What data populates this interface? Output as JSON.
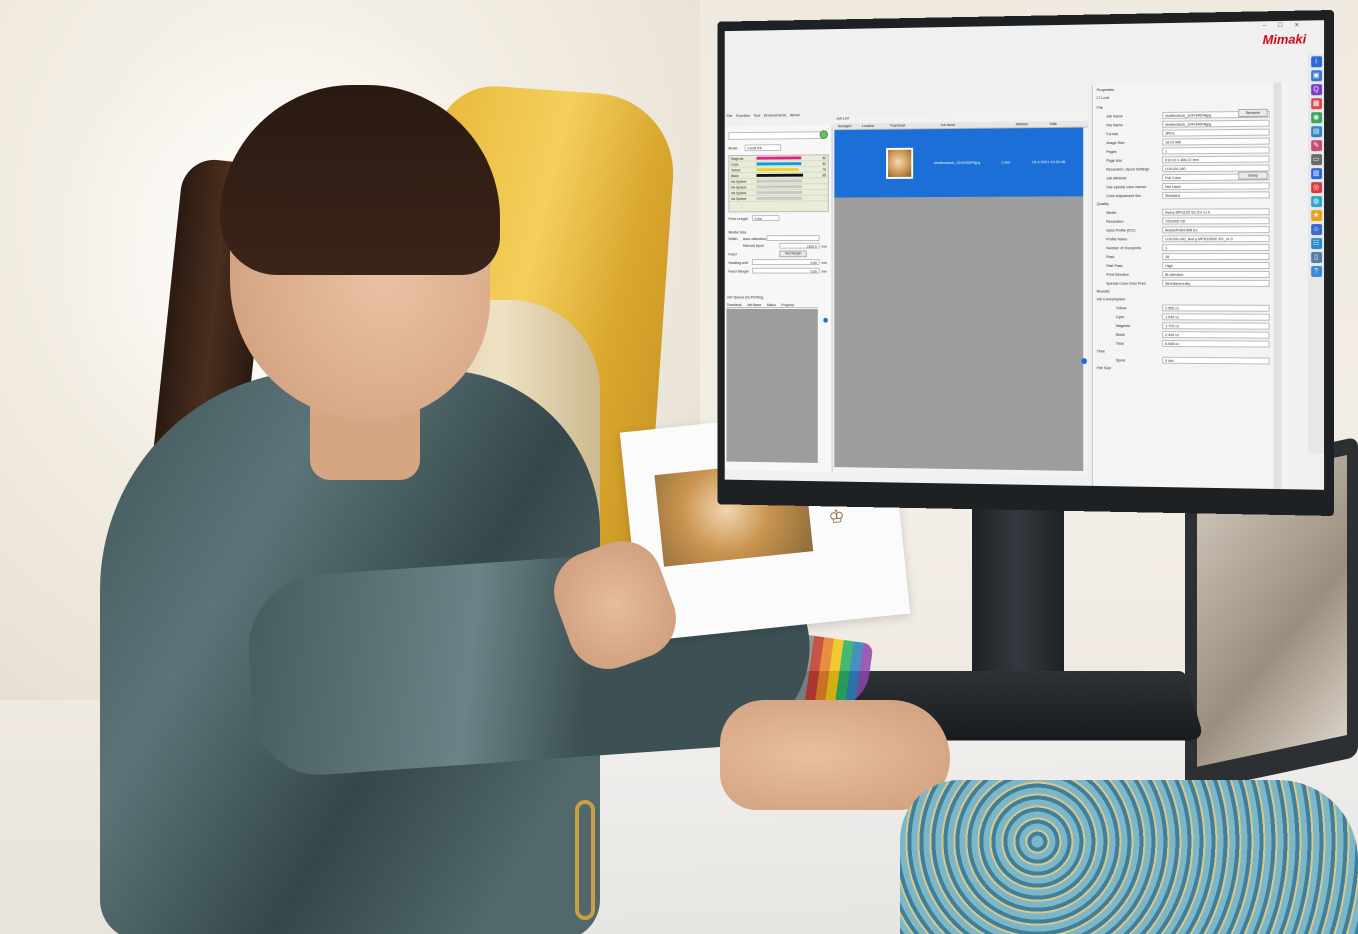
{
  "window": {
    "brand": "Mimaki",
    "controls": "–  ☐  ✕"
  },
  "menu": [
    "File",
    "Function",
    "Tool",
    "Environments",
    "About"
  ],
  "left_panel": {
    "mode_label": "Mode",
    "mode_value": "Local ink",
    "inks": [
      {
        "name": "Magenta",
        "color": "#e0218a",
        "value": "82"
      },
      {
        "name": "Cyan",
        "color": "#00a0e0",
        "value": "81"
      },
      {
        "name": "Yellow",
        "color": "#f3d11a",
        "value": "76"
      },
      {
        "name": "Black",
        "color": "#111111",
        "value": "85"
      },
      {
        "name": "Ink Sphere",
        "color": "#c8c8c8",
        "value": ""
      },
      {
        "name": "Ink Sphere",
        "color": "#c8c8c8",
        "value": ""
      },
      {
        "name": "Ink Sphere",
        "color": "#c8c8c8",
        "value": ""
      },
      {
        "name": "Ink Sphere",
        "color": "#c8c8c8",
        "value": ""
      }
    ],
    "print_length_label": "Print Length",
    "print_length_value": "0.0m",
    "media_size_label": "Media Size",
    "width_label": "Width",
    "auto_detection": "Auto detection",
    "manual_input": "Manual input",
    "width_value": "1620.0",
    "feed_label": "Feed",
    "test_margin": "Test Margin",
    "heating_unit_label": "Heating unit",
    "heating_unit_value": "0.00",
    "feed_margin_label": "Feed Margin",
    "feed_margin_value": "0.00",
    "unit_mm": "mm",
    "queue_title": "Job Queue (0) Printing",
    "queue_headers": [
      "Thumbnail",
      "Job Name",
      "Status",
      "Progress"
    ]
  },
  "job_list": {
    "tab_label": "Job List",
    "headers": [
      "Arranged",
      "Location",
      "Thumbnail",
      "Job Name",
      "Attribute",
      "Date"
    ],
    "rows": [
      {
        "name": "shutterstock_1244340FAjpg",
        "attribute": "Color",
        "date": "15-3-2021 13:31:48"
      }
    ]
  },
  "properties": {
    "title": "Properties",
    "lock_label": "Lock",
    "sections": {
      "file": "File",
      "quality": "Quality",
      "results": "Results",
      "ink_consumption": "Ink Consumption",
      "time": "Time"
    },
    "rename_button": "Rename",
    "setup_button": "Setup",
    "file_rows": [
      {
        "k": "Job Name",
        "v": "shutterstock_1244340FAjpg"
      },
      {
        "k": "File Name",
        "v": "shutterstock_1244340FAjpg"
      },
      {
        "k": "Format",
        "v": "JPEG"
      },
      {
        "k": "Image Size",
        "v": "16.01 MB"
      },
      {
        "k": "Pages",
        "v": "1"
      },
      {
        "k": "Page size",
        "v": "610.00 x 406.22 mm"
      },
      {
        "k": "Resolution, Spool Settings",
        "v": "UJV100-160"
      },
      {
        "k": "Job Attribute",
        "v": "Full Color"
      },
      {
        "k": "Use special color names",
        "v": "Not Used"
      },
      {
        "k": "Color Adjustment Set",
        "v": "Standard"
      }
    ],
    "quality_rows": [
      {
        "k": "Media",
        "v": "Avery MPI1105 SC EV v1.0"
      },
      {
        "k": "Resolution",
        "v": "720x900 VD"
      },
      {
        "k": "Input Profile (ICC)",
        "v": "AdobeRGB1998.icc"
      },
      {
        "k": "Profile Name",
        "v": "UJV100-160_Avery MPI1105SC EV_v1.0"
      },
      {
        "k": "Number of Overprints",
        "v": "1"
      },
      {
        "k": "Pass",
        "v": "16"
      },
      {
        "k": "Fast Pass",
        "v": "High"
      },
      {
        "k": "Print Direction",
        "v": "Bi-direction"
      },
      {
        "k": "Special Color Over Print",
        "v": "Simultaneously"
      }
    ],
    "ink_rows": [
      {
        "k": "Yellow",
        "v": "2.556 cc"
      },
      {
        "k": "Cyan",
        "v": "1.045 cc"
      },
      {
        "k": "Magenta",
        "v": "1.703 cc"
      },
      {
        "k": "Black",
        "v": "2.494 cc"
      },
      {
        "k": "Total",
        "v": "8.008 cc"
      }
    ],
    "time_rows": [
      {
        "k": "Spool",
        "v": "0 sec"
      }
    ],
    "file_size_label": "File Size"
  },
  "toolbar_icons": [
    {
      "name": "info-icon",
      "color": "#2a6ad6",
      "glyph": "i"
    },
    {
      "name": "device-icon",
      "color": "#3a78d0",
      "glyph": "▣"
    },
    {
      "name": "search-icon",
      "color": "#7a3cc4",
      "glyph": "Q"
    },
    {
      "name": "layout-icon",
      "color": "#d84b4b",
      "glyph": "▦"
    },
    {
      "name": "color-icon",
      "color": "#3ba55c",
      "glyph": "◉"
    },
    {
      "name": "profile-icon",
      "color": "#2f86c8",
      "glyph": "▤"
    },
    {
      "name": "edit-icon",
      "color": "#c84b7a",
      "glyph": "✎"
    },
    {
      "name": "folder-icon",
      "color": "#6a6a6a",
      "glyph": "▭"
    },
    {
      "name": "print-icon",
      "color": "#2a6ad6",
      "glyph": "▥"
    },
    {
      "name": "target-icon",
      "color": "#d83b3b",
      "glyph": "◎"
    },
    {
      "name": "palette-icon",
      "color": "#2aa6c8",
      "glyph": "◍"
    },
    {
      "name": "star-icon",
      "color": "#e8a21a",
      "glyph": "★"
    },
    {
      "name": "user-icon",
      "color": "#3a6ad0",
      "glyph": "☺"
    },
    {
      "name": "group-icon",
      "color": "#2a8ad6",
      "glyph": "☷"
    },
    {
      "name": "trash-icon",
      "color": "#5a7aa8",
      "glyph": "▯"
    },
    {
      "name": "help-icon",
      "color": "#3a8ad6",
      "glyph": "?"
    }
  ]
}
